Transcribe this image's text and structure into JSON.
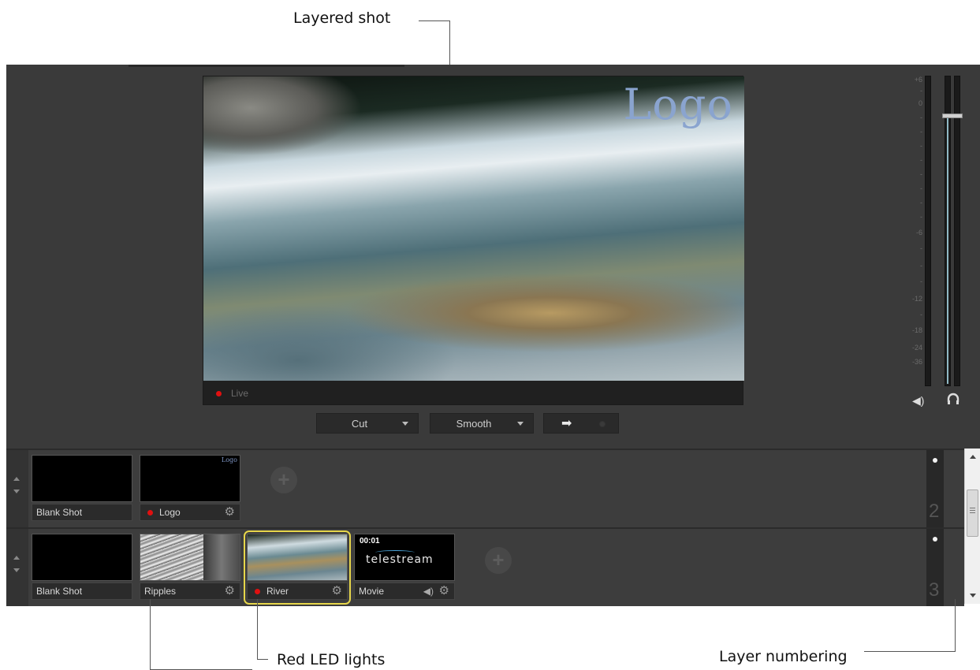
{
  "callouts": {
    "layered_shot": "Layered shot",
    "red_led_lights": "Red LED lights",
    "layer_numbering": "Layer numbering"
  },
  "preview": {
    "overlay_text": "Logo",
    "status_label": "Live",
    "status_color": "#e01010"
  },
  "transition": {
    "type_label": "Cut",
    "style_label": "Smooth",
    "go_icon": "arrow-right-icon"
  },
  "audio_meter": {
    "scale": [
      "+6",
      "-",
      "0",
      "-",
      "-",
      "-",
      "-",
      "-",
      "-",
      "-",
      "-",
      "-6",
      "-",
      "-",
      "-",
      "-12",
      "-",
      "-18",
      "-24",
      "-36"
    ],
    "speaker_icon": "speaker-icon",
    "headphone_icon": "headphone-icon"
  },
  "layers": [
    {
      "number": "2",
      "shots": [
        {
          "label": "Blank Shot",
          "live": false
        },
        {
          "label": "Logo",
          "live": true,
          "thumb_text": "Logo"
        }
      ]
    },
    {
      "number": "3",
      "shots": [
        {
          "label": "Blank Shot",
          "live": false
        },
        {
          "label": "Ripples",
          "live": false
        },
        {
          "label": "River",
          "live": true,
          "selected": true
        },
        {
          "label": "Movie",
          "live": false,
          "timecode": "00:01",
          "thumb_text": "telestream"
        }
      ]
    }
  ],
  "colors": {
    "accent_selected": "#e6d64a",
    "led_red": "#e01010",
    "panel_bg": "#3a3a3a"
  }
}
